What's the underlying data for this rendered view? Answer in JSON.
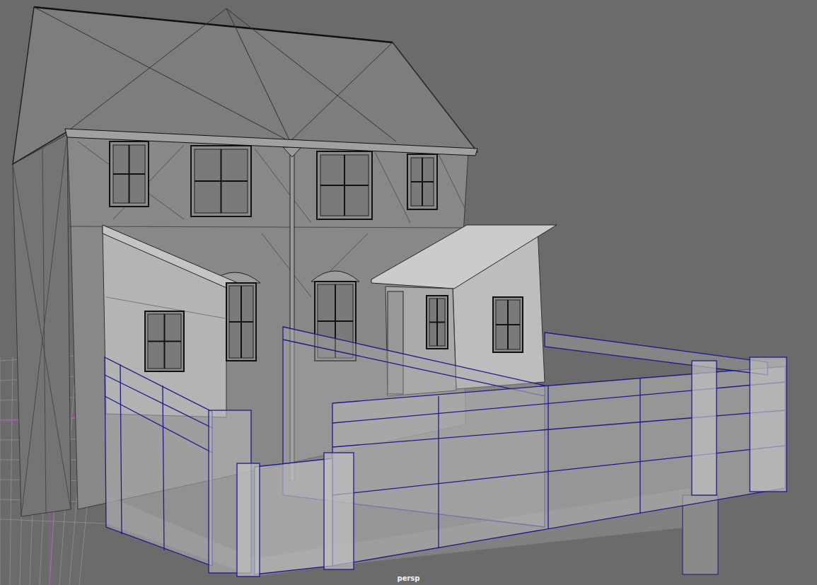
{
  "viewport": {
    "camera_label": "persp"
  }
}
